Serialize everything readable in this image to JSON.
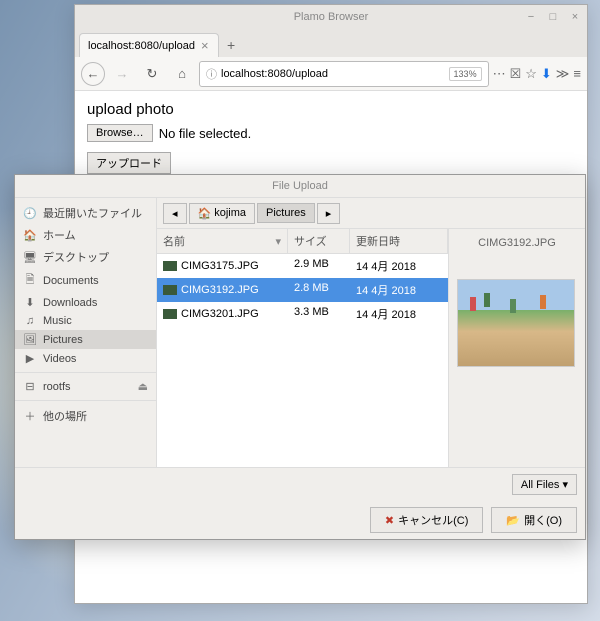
{
  "browser": {
    "title": "Plamo Browser",
    "tab_label": "localhost:8080/upload",
    "url_display": "localhost:8080/upload",
    "zoom": "133%"
  },
  "page": {
    "heading": "upload photo",
    "browse_label": "Browse…",
    "no_file": "No file selected.",
    "upload_label": "アップロード"
  },
  "dialog": {
    "title": "File Upload",
    "sidebar": [
      {
        "icon": "🕘",
        "label": "最近開いたファイル"
      },
      {
        "icon": "🏠",
        "label": "ホーム"
      },
      {
        "icon": "🖥",
        "label": "デスクトップ"
      },
      {
        "icon": "🗎",
        "label": "Documents"
      },
      {
        "icon": "⬇",
        "label": "Downloads"
      },
      {
        "icon": "♫",
        "label": "Music"
      },
      {
        "icon": "🖼",
        "label": "Pictures"
      },
      {
        "icon": "▶",
        "label": "Videos"
      }
    ],
    "rootfs_label": "rootfs",
    "other_label": "他の場所",
    "path": [
      "kojima",
      "Pictures"
    ],
    "columns": {
      "name": "名前",
      "size": "サイズ",
      "date": "更新日時"
    },
    "files": [
      {
        "name": "CIMG3175.JPG",
        "size": "2.9 MB",
        "date": "14 4月 2018"
      },
      {
        "name": "CIMG3192.JPG",
        "size": "2.8 MB",
        "date": "14 4月 2018"
      },
      {
        "name": "CIMG3201.JPG",
        "size": "3.3 MB",
        "date": "14 4月 2018"
      }
    ],
    "selected_index": 1,
    "preview_name": "CIMG3192.JPG",
    "filter_label": "All Files",
    "cancel_label": "キャンセル(C)",
    "open_label": "開く(O)"
  }
}
